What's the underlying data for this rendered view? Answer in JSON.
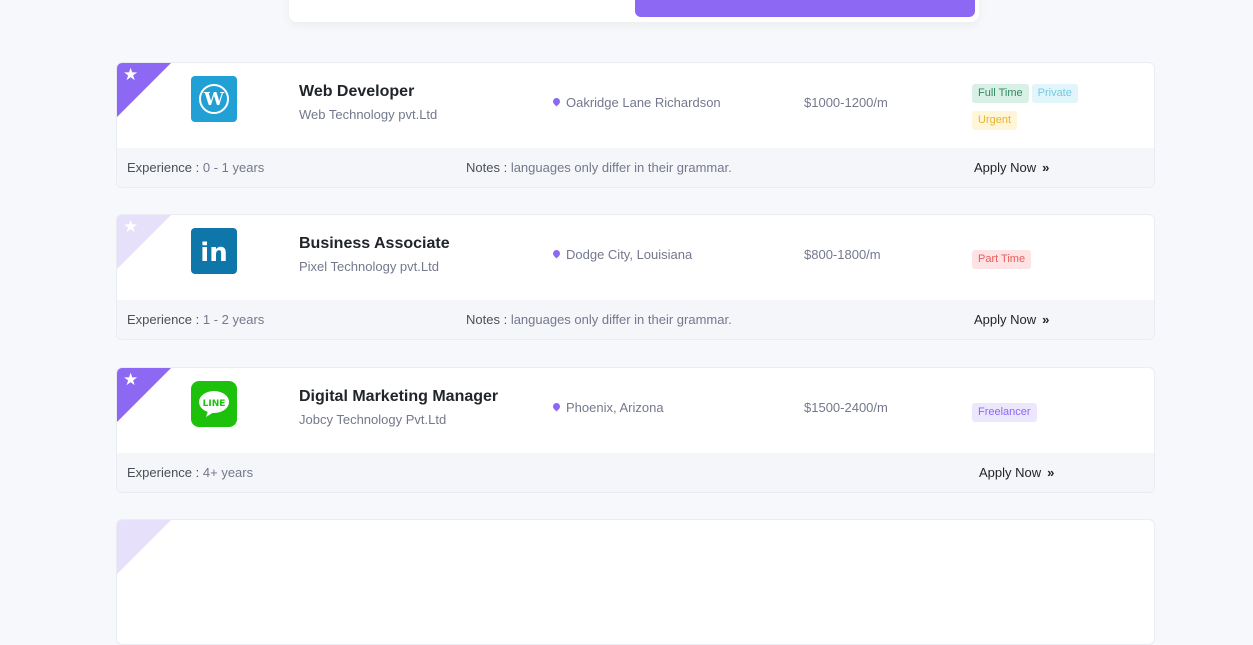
{
  "jobs": [
    {
      "featured": true,
      "logo_icon": "wordpress-icon",
      "logo_color": "#21a0d6",
      "title": "Web Developer",
      "company": "Web Technology pvt.Ltd",
      "location": "Oakridge Lane Richardson",
      "salary": "$1000-1200/m",
      "badges": [
        "Full Time",
        "Private",
        "Urgent"
      ],
      "experience_label": "Experience :",
      "experience": "0 - 1 years",
      "notes_label": "Notes :",
      "notes": "languages only differ in their grammar.",
      "apply": "Apply Now"
    },
    {
      "featured": false,
      "logo_icon": "linkedin-icon",
      "logo_color": "#0e76a8",
      "title": "Business Associate",
      "company": "Pixel Technology pvt.Ltd",
      "location": "Dodge City, Louisiana",
      "salary": "$800-1800/m",
      "badges": [
        "Part Time"
      ],
      "experience_label": "Experience :",
      "experience": "1 - 2 years",
      "notes_label": "Notes :",
      "notes": "languages only differ in their grammar.",
      "apply": "Apply Now"
    },
    {
      "featured": true,
      "logo_icon": "line-app-icon",
      "logo_color": "#1dc10b",
      "title": "Digital Marketing Manager",
      "company": "Jobcy Technology Pvt.Ltd",
      "location": "Phoenix, Arizona",
      "salary": "$1500-2400/m",
      "badges": [
        "Freelancer"
      ],
      "experience_label": "Experience :",
      "experience": "4+ years",
      "apply": "Apply Now"
    }
  ],
  "colors": {
    "accent": "#8c68f3",
    "page_bg": "#f7f8fb"
  }
}
